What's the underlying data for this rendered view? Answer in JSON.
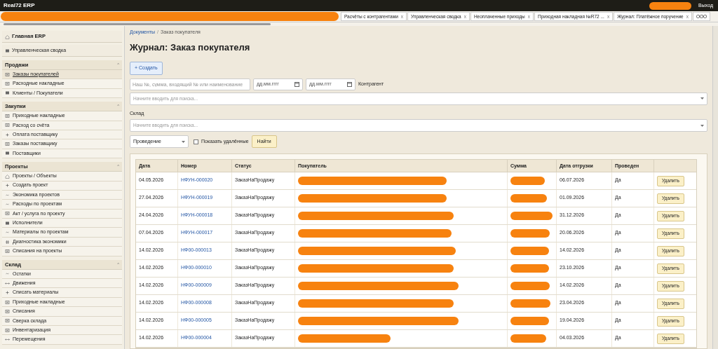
{
  "app": {
    "title": "Real72 ERP",
    "logout": "Выход"
  },
  "tabs": [
    {
      "label": "Расчёты с контрагентами",
      "close": "x"
    },
    {
      "label": "Управленческая сводка",
      "close": "x"
    },
    {
      "label": "Неоплаченные приходы",
      "close": "x"
    },
    {
      "label": "Приходная накладная №R72 ...",
      "close": "x"
    },
    {
      "label": "Журнал: Платёжное поручение",
      "close": "x"
    },
    {
      "label": "ООО"
    }
  ],
  "sidebar": {
    "top": [
      {
        "label": "Главная ERP",
        "kind": "home",
        "bold": true
      },
      {
        "label": "Управленческая сводка",
        "kind": "square",
        "bold": false
      }
    ],
    "sections": [
      {
        "title": "Продажи",
        "toggle": "^",
        "expanded": true,
        "items": [
          {
            "label": "Заказы покупателей",
            "kind": "boxed",
            "selected": true
          },
          {
            "label": "Расходные накладные",
            "kind": "boxed",
            "selected": false
          },
          {
            "label": "Клиенты / Покупатели",
            "kind": "square",
            "selected": false
          }
        ]
      },
      {
        "title": "Закупки",
        "toggle": "^",
        "expanded": true,
        "items": [
          {
            "label": "Приходные накладные",
            "kind": "boxed",
            "selected": false
          },
          {
            "label": "Расход со счёта",
            "kind": "boxed",
            "selected": false
          },
          {
            "label": "Оплата поставщику",
            "kind": "plus",
            "selected": false
          },
          {
            "label": "Заказы поставщику",
            "kind": "boxed",
            "selected": false
          },
          {
            "label": "Поставщики",
            "kind": "square",
            "selected": false
          }
        ]
      },
      {
        "title": "Проекты",
        "toggle": "^",
        "expanded": true,
        "items": [
          {
            "label": "Проекты / Объекты",
            "kind": "home",
            "selected": false
          },
          {
            "label": "Создать проект",
            "kind": "plus",
            "selected": false
          },
          {
            "label": "Экономика проектов",
            "kind": "tilde",
            "selected": false
          },
          {
            "label": "Расходы по проектам",
            "kind": "tilde",
            "selected": false
          },
          {
            "label": "Акт / услуга по проекту",
            "kind": "boxed",
            "selected": false
          },
          {
            "label": "Исполнители",
            "kind": "square",
            "selected": false
          },
          {
            "label": "Материалы по проектам",
            "kind": "tilde",
            "selected": false
          },
          {
            "label": "Диагностика экономики",
            "kind": "hash",
            "selected": false
          },
          {
            "label": "Списания на проекты",
            "kind": "boxed",
            "selected": false
          }
        ]
      },
      {
        "title": "Склад",
        "toggle": "^",
        "expanded": true,
        "items": [
          {
            "label": "Остатки",
            "kind": "tilde",
            "selected": false
          },
          {
            "label": "Движения",
            "kind": "arrows",
            "selected": false
          },
          {
            "label": "Списать материалы",
            "kind": "plus",
            "selected": false
          },
          {
            "label": "Приходные накладные",
            "kind": "boxed",
            "selected": false
          },
          {
            "label": "Списания",
            "kind": "boxed",
            "selected": false
          },
          {
            "label": "Сверка склада",
            "kind": "boxed",
            "selected": false
          },
          {
            "label": "Инвентаризация",
            "kind": "boxed",
            "selected": false
          },
          {
            "label": "Перемещения",
            "kind": "arrows",
            "selected": false
          }
        ]
      }
    ]
  },
  "breadcrumb": {
    "link": "Документы",
    "separator": "/",
    "current": "Заказ покупателя"
  },
  "page_title": "Журнал: Заказ покупателя",
  "create_button": "+ Создать",
  "filters": {
    "search": {
      "placeholder": "Наш №, сумма, входящий № или наименование"
    },
    "date_from": {
      "placeholder": "дд.мм.гггг"
    },
    "date_to": {
      "placeholder": "дд.мм.гггг"
    },
    "counterparty": {
      "label": "Контрагент",
      "placeholder": "Начните вводить для поиска..."
    },
    "warehouse": {
      "label": "Склад",
      "placeholder": "Начните вводить для поиска..."
    },
    "posting": {
      "value": "Проведение"
    },
    "show_deleted": {
      "label": "Показать удалённые",
      "checked": false
    },
    "find_button": "Найти"
  },
  "table": {
    "columns": [
      "Дата",
      "Номер",
      "Статус",
      "Покупатель",
      "Сумма",
      "Дата отгрузки",
      "Проведен"
    ],
    "rows": [
      {
        "date": "04.05.2026",
        "number": "НФУН-000020",
        "status": "ЗаказНаПродажу",
        "ship_date": "06.07.2026",
        "posted": "Да",
        "action": "Удалить"
      },
      {
        "date": "27.04.2026",
        "number": "НФУН-000019",
        "status": "ЗаказНаПродажу",
        "ship_date": "01.09.2026",
        "posted": "Да",
        "action": "Удалить"
      },
      {
        "date": "24.04.2026",
        "number": "НФУН-000018",
        "status": "ЗаказНаПродажу",
        "ship_date": "31.12.2026",
        "posted": "Да",
        "action": "Удалить"
      },
      {
        "date": "07.04.2026",
        "number": "НФУН-000017",
        "status": "ЗаказНаПродажу",
        "ship_date": "20.06.2026",
        "posted": "Да",
        "action": "Удалить"
      },
      {
        "date": "14.02.2026",
        "number": "НФ00-000013",
        "status": "ЗаказНаПродажу",
        "ship_date": "14.02.2026",
        "posted": "Да",
        "action": "Удалить"
      },
      {
        "date": "14.02.2026",
        "number": "НФ00-000010",
        "status": "ЗаказНаПродажу",
        "ship_date": "23.10.2026",
        "posted": "Да",
        "action": "Удалить"
      },
      {
        "date": "14.02.2026",
        "number": "НФ00-000009",
        "status": "ЗаказНаПродажу",
        "ship_date": "14.02.2026",
        "posted": "Да",
        "action": "Удалить"
      },
      {
        "date": "14.02.2026",
        "number": "НФ00-000008",
        "status": "ЗаказНаПродажу",
        "ship_date": "23.04.2026",
        "posted": "Да",
        "action": "Удалить"
      },
      {
        "date": "14.02.2026",
        "number": "НФ00-000005",
        "status": "ЗаказНаПродажу",
        "ship_date": "19.04.2026",
        "posted": "Да",
        "action": "Удалить"
      },
      {
        "date": "14.02.2026",
        "number": "НФ00-000004",
        "status": "ЗаказНаПродажу",
        "ship_date": "04.03.2026",
        "posted": "Да",
        "action": "Удалить"
      }
    ]
  }
}
